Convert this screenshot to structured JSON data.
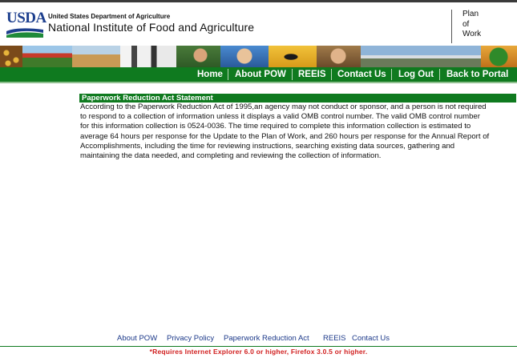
{
  "header": {
    "logo_text": "USDA",
    "department": "United States Department of Agriculture",
    "institute": "National Institute of Food and Agriculture",
    "plan_of_work": [
      "Plan",
      "of",
      "Work"
    ]
  },
  "nav": {
    "items": [
      "Home",
      "About POW",
      "REEIS",
      "Contact Us",
      "Log Out",
      "Back to Portal"
    ]
  },
  "content": {
    "section_title": "Paperwork Reduction Act Statement",
    "lines": [
      "According to the Paperwork Reduction Act of 1995,an agency may not conduct or sponsor, and a person is not required",
      "to respond to a collection of information unless it displays a valid OMB control number. The valid OMB control number",
      "for this information collection is 0524-0036. The time required to complete this information collection is estimated to",
      "average 64 hours per response for the Update to the Plan of Work, and 260 hours per response for the Annual Report of",
      "Accomplishments, including the time for reviewing instructions, searching existing data sources, gathering and",
      "maintaining the data needed, and completing and reviewing the collection of information."
    ]
  },
  "footer": {
    "links": [
      "About POW",
      "Privacy Policy",
      "Paperwork Reduction Act",
      "REEIS",
      "Contact Us"
    ],
    "requirement": "*Requires Internet Explorer 6.0 or higher, Firefox 3.0.5 or higher."
  },
  "colors": {
    "nav_green": "#0f7a1f",
    "usda_blue": "#1d3f8e",
    "link_blue": "#1d3a8a",
    "warning_red": "#d12020"
  }
}
